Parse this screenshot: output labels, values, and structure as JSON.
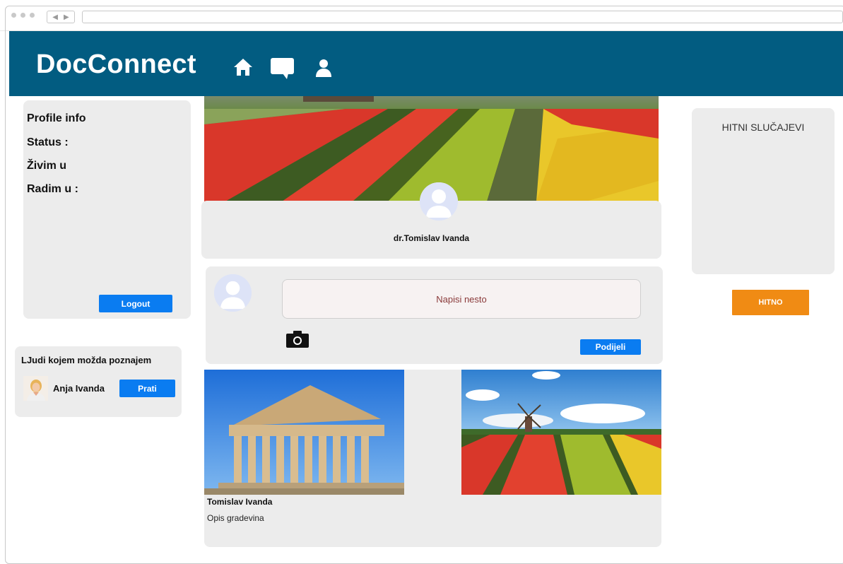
{
  "app": {
    "brand": "DocConnect",
    "header_color": "#025c81",
    "nav_icons": [
      "home-icon",
      "chat-icon",
      "profile-icon"
    ]
  },
  "profile_info": {
    "title": "Profile info",
    "status_label": "Status :",
    "lives_label": "Živim u",
    "works_label": "Radim u :",
    "logout_label": "Logout"
  },
  "people": {
    "title": "LJudi kojem možda poznajem",
    "person_name": "Anja Ivanda",
    "follow_label": "Prati"
  },
  "profile": {
    "name": "dr.Tomislav Ivanda"
  },
  "composer": {
    "placeholder": "Napisi nesto",
    "share_label": "Podijeli"
  },
  "feed": {
    "author": "Tomislav Ivanda",
    "description": "Opis gradevina"
  },
  "urgent": {
    "title": "HITNI SLUČAJEVI",
    "button_label": "HITNO",
    "button_color": "#f08b14"
  },
  "colors": {
    "primary_button": "#0a7cf1",
    "card_bg": "#ececec"
  }
}
